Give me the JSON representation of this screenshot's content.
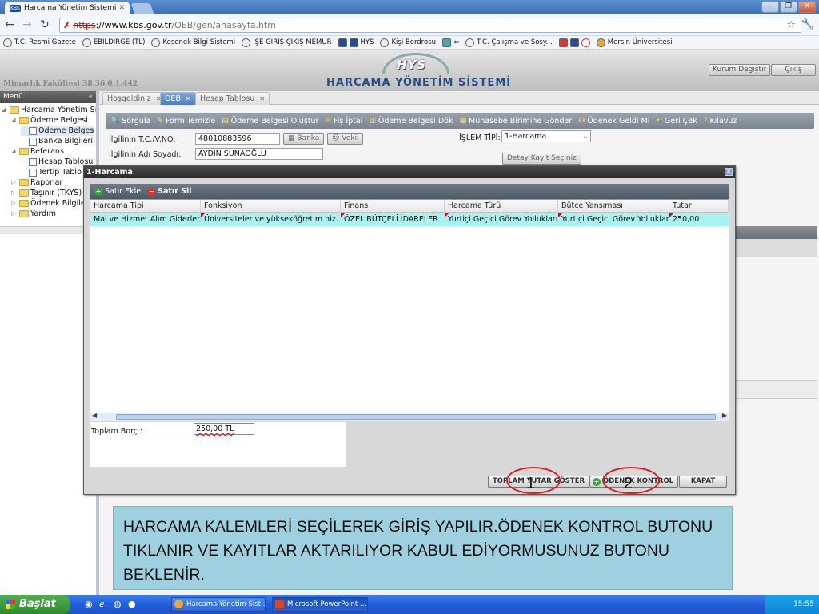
{
  "browser": {
    "tab_title": "Harcama Yönetim Sistemi",
    "tab_favicon": "KBS",
    "url_scheme": "https",
    "url_host": "://www.kbs.gov.tr",
    "url_path": "/OEB/gen/anasayfa.htm",
    "bookmarks": [
      "T.C. Resmi Gazete",
      "EBILDIRGE (TL)",
      "Kesenek Bilgi Sistemi",
      "İŞE GİRİŞ ÇIKIŞ MEMUR",
      "HYS",
      "Kişi Bordrosu",
      "T.C. Çalışma ve Sosy...",
      "Mersin Üniversitesi"
    ]
  },
  "header": {
    "ip_info": "Mimarlık Fakültesi 38.36.0.1.442",
    "logo": "HYS",
    "system_name": "HARCAMA YÖNETİM SİSTEMİ",
    "btn_change_institution": "Kurum Değiştir",
    "btn_exit": "Çıkış"
  },
  "menu": {
    "title": "Menü",
    "items": [
      {
        "label": "Harcama Yönetim Sis",
        "level": 0,
        "type": "folder",
        "toggle": "◢"
      },
      {
        "label": "Ödeme Belgesi",
        "level": 1,
        "type": "folder",
        "toggle": "◢"
      },
      {
        "label": "Ödeme Belges",
        "level": 2,
        "type": "doc",
        "toggle": ""
      },
      {
        "label": "Banka Bilgileri",
        "level": 2,
        "type": "doc",
        "toggle": ""
      },
      {
        "label": "Referans",
        "level": 1,
        "type": "folder",
        "toggle": "◢"
      },
      {
        "label": "Hesap Tablosu",
        "level": 2,
        "type": "doc",
        "toggle": ""
      },
      {
        "label": "Tertip Tablo",
        "level": 2,
        "type": "doc",
        "toggle": ""
      },
      {
        "label": "Raporlar",
        "level": 1,
        "type": "folder",
        "toggle": "▷"
      },
      {
        "label": "Taşınır (TKYS)",
        "level": 1,
        "type": "folder",
        "toggle": "▷"
      },
      {
        "label": "Ödenek Bilgile",
        "level": 1,
        "type": "folder",
        "toggle": "▷"
      },
      {
        "label": "Yardım",
        "level": 1,
        "type": "folder",
        "toggle": "▷"
      }
    ]
  },
  "main_tabs": [
    "Hoşgeldiniz",
    "OEB",
    "Hesap Tablosu"
  ],
  "toolbar": {
    "items": [
      "Sorgula",
      "Form Temizle",
      "Ödeme Belgesi Oluştur",
      "Fiş İptal",
      "Ödeme Belgesi Dök",
      "Muhasebe Birimine Gönder",
      "Ödenek Geldi Mi",
      "Geri Çek",
      "Kılavuz"
    ]
  },
  "form": {
    "tc_label": "İlgilinin T.C./V.NO:",
    "tc_value": "48010883596",
    "name_label": "İlgilinin Adı Soyadı:",
    "name_value": "AYDIN SUNAOĞLU",
    "btn_bank": "Banka",
    "btn_proxy": "Vekil",
    "islem_label": "İŞLEM TİPİ:",
    "islem_value": "1-Harcama",
    "btn_detail": "Detay Kayıt Seçiniz"
  },
  "modal": {
    "title": "1-Harcama",
    "btn_add_row": "Satır Ekle",
    "btn_delete_row": "Satır Sil",
    "columns": [
      "Harcama Tipi",
      "Fonksiyon",
      "Finans",
      "Harcama Türü",
      "Bütçe Yansıması",
      "Tutar"
    ],
    "rows": [
      [
        "Mal ve Hizmet Alım Giderleri",
        "Üniversiteler ve yükseköğretim hiz...",
        "ÖZEL BÜTÇELİ İDARELER",
        "Yurtiçi Geçici Görev Yollukları",
        "Yurtiçi Geçici Görev Yollukları",
        "250,00"
      ]
    ],
    "total_label": "Toplam Borç :",
    "total_value": "250,00 TL",
    "btn_show_total": "TOPLAM TUTAR GÖSTER",
    "btn_budget_check": "ÖDENEK KONTROL",
    "btn_close": "KAPAT",
    "marker_1": "1",
    "marker_2": "2"
  },
  "caption": "HARCAMA KALEMLERİ SEÇİLEREK GİRİŞ YAPILIR.ÖDENEK KONTROL BUTONU TIKLANIR VE KAYITLAR AKTARILIYOR KABUL EDİYORMUSUNUZ BUTONU BEKLENİR.",
  "taskbar": {
    "start": "Başlat",
    "tasks": [
      "Harcama Yönetim Sist...",
      "Microsoft PowerPoint ..."
    ],
    "clock": "15:55"
  }
}
